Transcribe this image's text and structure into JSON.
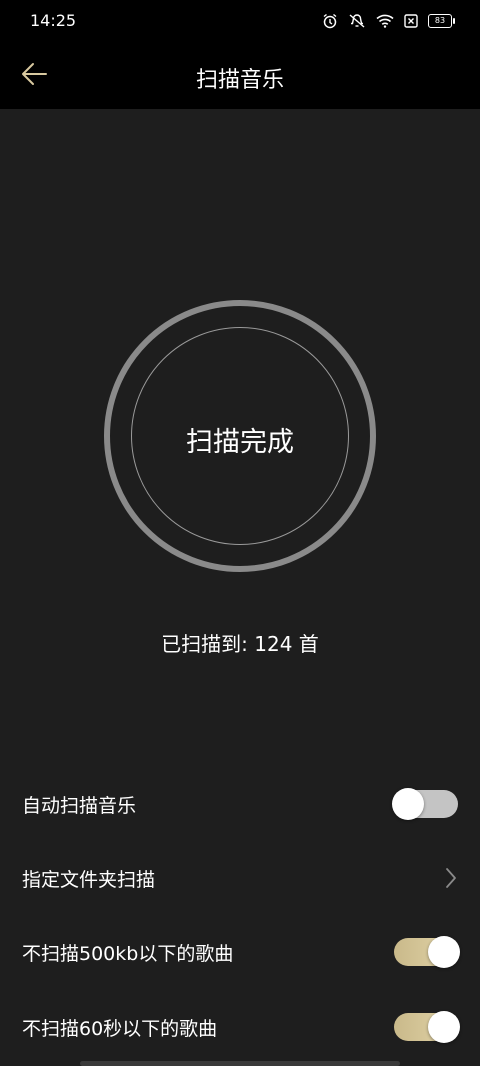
{
  "status_bar": {
    "time": "14:25",
    "battery": "83",
    "icons": [
      "alarm-icon",
      "mute-icon",
      "wifi-icon",
      "no-sim-icon",
      "battery-icon"
    ]
  },
  "header": {
    "title": "扫描音乐",
    "back_icon": "arrow-left-icon"
  },
  "scan": {
    "status": "扫描完成",
    "count_text": "已扫描到: 124 首"
  },
  "settings": [
    {
      "label": "自动扫描音乐",
      "control": "toggle",
      "enabled": false
    },
    {
      "label": "指定文件夹扫描",
      "control": "chevron"
    },
    {
      "label": "不扫描500kb以下的歌曲",
      "control": "toggle",
      "enabled": true
    },
    {
      "label": "不扫描60秒以下的歌曲",
      "control": "toggle",
      "enabled": true
    }
  ],
  "colors": {
    "background": "#1e1e1e",
    "bar": "#000000",
    "ring": "#8a8a8a",
    "toggle_on": "#d6c79a",
    "toggle_off": "#c4c4c4",
    "accent_back": "#d8c9a0"
  }
}
